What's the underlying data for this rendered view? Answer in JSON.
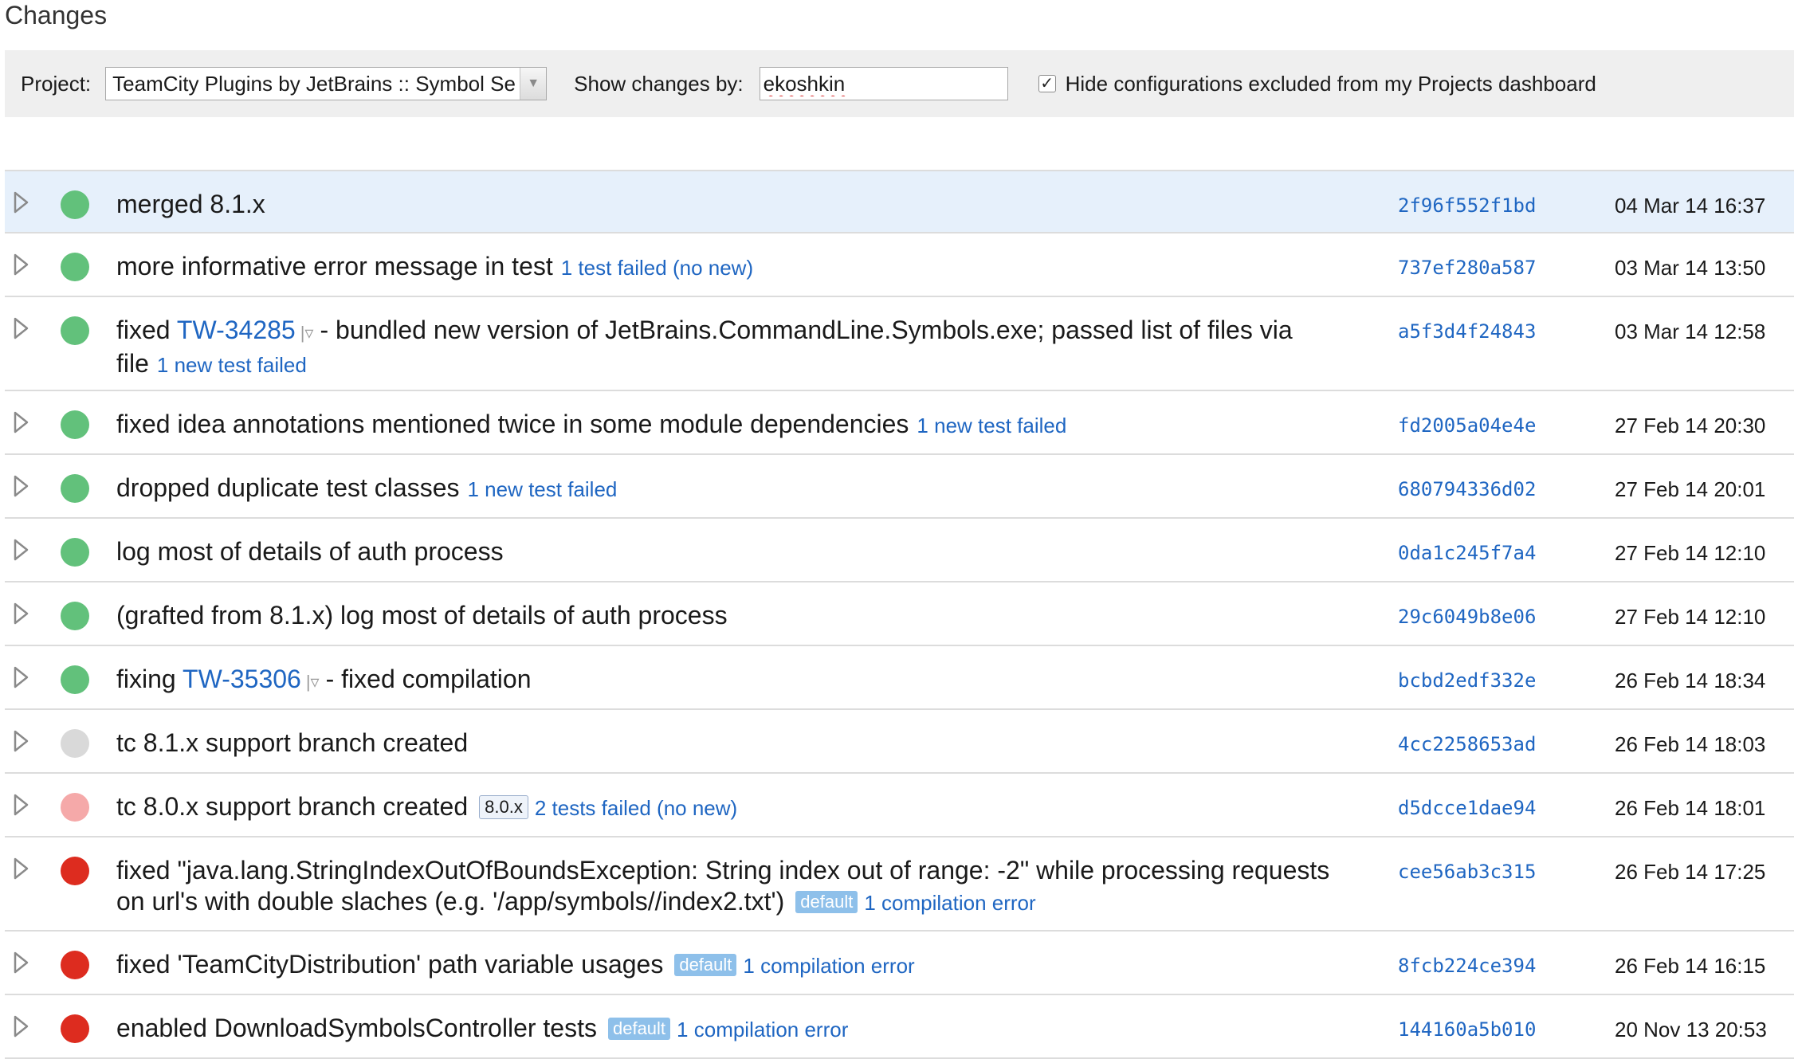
{
  "page_title": "Changes",
  "filters": {
    "project_label": "Project:",
    "project_value": "TeamCity Plugins by JetBrains :: Symbol Se",
    "show_changes_label": "Show changes by:",
    "user_value": "ekoshkin",
    "hide_checked": true,
    "hide_label": "Hide configurations excluded from my Projects dashboard"
  },
  "changes": [
    {
      "status": "success",
      "highlight": true,
      "lines": 1,
      "parts": [
        {
          "t": "text",
          "v": "merged 8.1.x"
        }
      ],
      "hash": "2f96f552f1bd",
      "date": "04 Mar 14 16:37"
    },
    {
      "status": "success",
      "lines": 1,
      "parts": [
        {
          "t": "text",
          "v": "more informative error message in test"
        },
        {
          "t": "note",
          "v": "1 test failed (no new)"
        }
      ],
      "hash": "737ef280a587",
      "date": "03 Mar 14 13:50"
    },
    {
      "status": "success",
      "lines": 2,
      "parts": [
        {
          "t": "text",
          "v": "fixed "
        },
        {
          "t": "issue",
          "v": "TW-34285"
        },
        {
          "t": "text",
          "v": "- bundled new version of JetBrains.CommandLine.Symbols.exe; passed list of files via file"
        },
        {
          "t": "note",
          "v": "1 new test failed"
        }
      ],
      "hash": "a5f3d4f24843",
      "date": "03 Mar 14 12:58"
    },
    {
      "status": "success",
      "lines": 1,
      "parts": [
        {
          "t": "text",
          "v": "fixed idea annotations mentioned twice in some module dependencies"
        },
        {
          "t": "note",
          "v": "1 new test failed"
        }
      ],
      "hash": "fd2005a04e4e",
      "date": "27 Feb 14 20:30"
    },
    {
      "status": "success",
      "lines": 1,
      "parts": [
        {
          "t": "text",
          "v": "dropped duplicate test classes"
        },
        {
          "t": "note",
          "v": "1 new test failed"
        }
      ],
      "hash": "680794336d02",
      "date": "27 Feb 14 20:01"
    },
    {
      "status": "success",
      "lines": 1,
      "parts": [
        {
          "t": "text",
          "v": "log most of details of auth process"
        }
      ],
      "hash": "0da1c245f7a4",
      "date": "27 Feb 14 12:10"
    },
    {
      "status": "success",
      "lines": 1,
      "parts": [
        {
          "t": "text",
          "v": "(grafted from 8.1.x) log most of details of auth process"
        }
      ],
      "hash": "29c6049b8e06",
      "date": "27 Feb 14 12:10"
    },
    {
      "status": "success",
      "lines": 1,
      "parts": [
        {
          "t": "text",
          "v": "fixing "
        },
        {
          "t": "issue",
          "v": "TW-35306"
        },
        {
          "t": "text",
          "v": "- fixed compilation"
        }
      ],
      "hash": "bcbd2edf332e",
      "date": "26 Feb 14 18:34"
    },
    {
      "status": "unknown",
      "lines": 1,
      "parts": [
        {
          "t": "text",
          "v": "tc 8.1.x support branch created"
        }
      ],
      "hash": "4cc2258653ad",
      "date": "26 Feb 14 18:03"
    },
    {
      "status": "failed-light",
      "lines": 1,
      "parts": [
        {
          "t": "text",
          "v": "tc 8.0.x support branch created"
        },
        {
          "t": "tag-outline",
          "v": "8.0.x"
        },
        {
          "t": "note",
          "v": "2 tests failed (no new)"
        }
      ],
      "hash": "d5dcce1dae94",
      "date": "26 Feb 14 18:01"
    },
    {
      "status": "failed",
      "lines": 2,
      "parts": [
        {
          "t": "text",
          "v": "fixed \"java.lang.StringIndexOutOfBoundsException: String index out of range: -2\" while processing requests on url's with double slaches (e.g. '/app/symbols//index2.txt')"
        },
        {
          "t": "tag-filled",
          "v": "default"
        },
        {
          "t": "note",
          "v": "1 compilation error"
        }
      ],
      "hash": "cee56ab3c315",
      "date": "26 Feb 14 17:25"
    },
    {
      "status": "failed",
      "lines": 1,
      "parts": [
        {
          "t": "text",
          "v": "fixed 'TeamCityDistribution' path variable usages"
        },
        {
          "t": "tag-filled",
          "v": "default"
        },
        {
          "t": "note",
          "v": "1 compilation error"
        }
      ],
      "hash": "8fcb224ce394",
      "date": "26 Feb 14 16:15"
    },
    {
      "status": "failed",
      "lines": 1,
      "parts": [
        {
          "t": "text",
          "v": "enabled DownloadSymbolsController tests"
        },
        {
          "t": "tag-filled",
          "v": "default"
        },
        {
          "t": "note",
          "v": "1 compilation error"
        }
      ],
      "hash": "144160a5b010",
      "date": "20 Nov 13 20:53"
    }
  ]
}
